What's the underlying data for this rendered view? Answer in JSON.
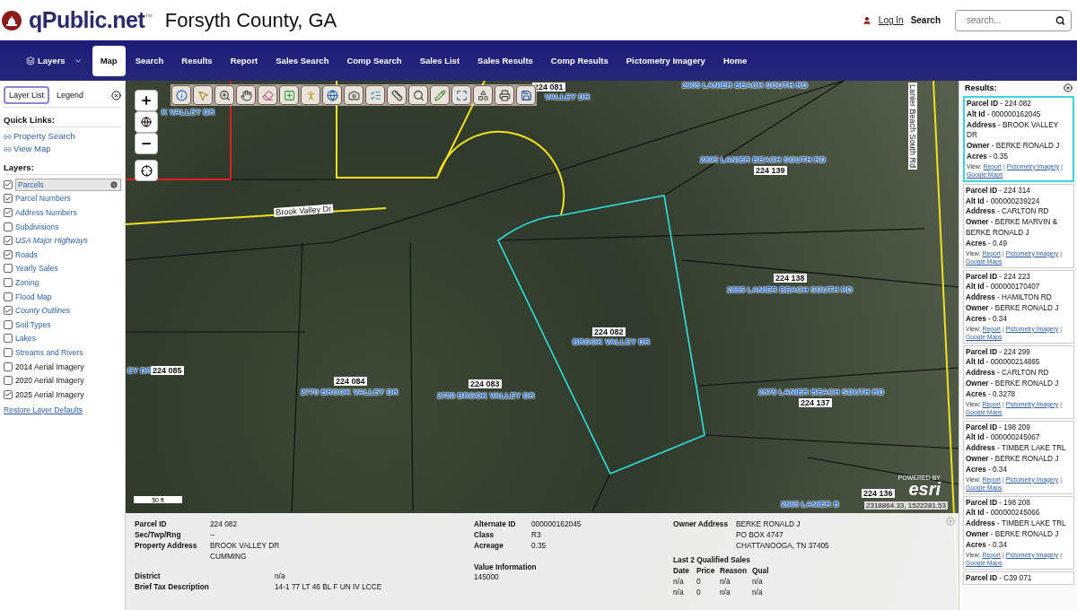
{
  "header": {
    "brand": "qPublic.net$^{™}$",
    "county": "Forsyth County, GA",
    "login": "Log In",
    "search_label": "Search",
    "search": {
      "placeholder": "search..."
    }
  },
  "nav": [
    {
      "label": "Layers",
      "kind": "dropdown",
      "selected": false
    },
    {
      "label": "Map",
      "kind": "link",
      "selected": true
    },
    {
      "label": "Search",
      "kind": "link",
      "selected": false
    },
    {
      "label": "Results",
      "kind": "link",
      "selected": false
    },
    {
      "label": "Report",
      "kind": "link",
      "selected": false
    },
    {
      "label": "Sales Search",
      "kind": "link",
      "selected": false
    },
    {
      "label": "Comp Search",
      "kind": "link",
      "selected": false
    },
    {
      "label": "Sales List",
      "kind": "link",
      "selected": false
    },
    {
      "label": "Sales Results",
      "kind": "link",
      "selected": false
    },
    {
      "label": "Comp Results",
      "kind": "link",
      "selected": false
    },
    {
      "label": "Pictometry Imagery",
      "kind": "link",
      "selected": false
    },
    {
      "label": "Home",
      "kind": "link",
      "selected": false
    }
  ],
  "sidebar": {
    "tabs": [
      {
        "label": "Layer List",
        "selected": true
      },
      {
        "label": "Legend",
        "selected": false
      }
    ],
    "quick_links_title": "Quick Links:",
    "quick_links": [
      "Property Search",
      "View Map"
    ],
    "layers_title": "Layers:",
    "layers": [
      {
        "label": "Parcels",
        "checked": true,
        "selected": true,
        "italic": false,
        "kind": "layer"
      },
      {
        "label": "Parcel Numbers",
        "checked": true,
        "selected": false,
        "italic": false,
        "kind": "layer"
      },
      {
        "label": "Address Numbers",
        "checked": true,
        "selected": false,
        "italic": false,
        "kind": "layer"
      },
      {
        "label": "Subdivisions",
        "checked": false,
        "selected": false,
        "italic": false,
        "kind": "layer"
      },
      {
        "label": "USA Major Highways",
        "checked": true,
        "selected": false,
        "italic": true,
        "kind": "layer"
      },
      {
        "label": "Roads",
        "checked": true,
        "selected": false,
        "italic": false,
        "kind": "layer"
      },
      {
        "label": "Yearly Sales",
        "checked": false,
        "selected": false,
        "italic": false,
        "kind": "layer"
      },
      {
        "label": "Zoning",
        "checked": false,
        "selected": false,
        "italic": false,
        "kind": "layer"
      },
      {
        "label": "Flood Map",
        "checked": false,
        "selected": false,
        "italic": false,
        "kind": "layer"
      },
      {
        "label": "County Outlines",
        "checked": true,
        "selected": false,
        "italic": true,
        "kind": "layer"
      },
      {
        "label": "Soil Types",
        "checked": false,
        "selected": false,
        "italic": false,
        "kind": "layer"
      },
      {
        "label": "Lakes",
        "checked": false,
        "selected": false,
        "italic": false,
        "kind": "layer"
      },
      {
        "label": "Streams and Rivers",
        "checked": false,
        "selected": false,
        "italic": false,
        "kind": "layer"
      },
      {
        "label": "2014 Aerial Imagery",
        "checked": false,
        "selected": false,
        "italic": false,
        "kind": "basemap"
      },
      {
        "label": "2020 Aerial Imagery",
        "checked": false,
        "selected": false,
        "italic": false,
        "kind": "basemap"
      },
      {
        "label": "2025 Aerial Imagery",
        "checked": true,
        "selected": false,
        "italic": false,
        "kind": "basemap"
      }
    ],
    "restore": "Restore Layer Defaults"
  },
  "map": {
    "labels": [
      {
        "text": "K VALLEY DR",
        "kind": "address"
      },
      {
        "text": "224  081",
        "kind": "number"
      },
      {
        "text": "VALLEY DR",
        "kind": "address"
      },
      {
        "text": "2905 LANIER BEACH SOUTH RD",
        "kind": "address"
      },
      {
        "text": "2895 LANIER BEACH SOUTH RD",
        "kind": "address"
      },
      {
        "text": "224  139",
        "kind": "number"
      },
      {
        "text": "224  138",
        "kind": "number"
      },
      {
        "text": "2885 LANIER BEACH SOUTH RD",
        "kind": "address"
      },
      {
        "text": "224  082",
        "kind": "number"
      },
      {
        "text": "BROOK VALLEY DR",
        "kind": "address"
      },
      {
        "text": "EY DR",
        "kind": "address"
      },
      {
        "text": "224  085",
        "kind": "number"
      },
      {
        "text": "224  084",
        "kind": "number"
      },
      {
        "text": "2770 BROOK VALLEY DR",
        "kind": "address"
      },
      {
        "text": "224  083",
        "kind": "number"
      },
      {
        "text": "2780 BROOK VALLEY DR",
        "kind": "address"
      },
      {
        "text": "2875 LANIER BEACH SOUTH RD",
        "kind": "address"
      },
      {
        "text": "224  137",
        "kind": "number"
      },
      {
        "text": "224  136",
        "kind": "number"
      },
      {
        "text": "2865 LANIER B",
        "kind": "address"
      },
      {
        "text": "Brook Valley Dr",
        "kind": "road"
      },
      {
        "text": "Lanier Beach South Rd",
        "kind": "road"
      }
    ],
    "scale": "50 ft",
    "coordinates": "2318864.33, 1522281.53",
    "esri_caption": "POWERED BY",
    "esri": "esri"
  },
  "info": {
    "col1": [
      {
        "label": "Parcel ID",
        "value": [
          "224 082"
        ]
      },
      {
        "label": "Sec/Twp/Rng",
        "value": [
          "--"
        ]
      },
      {
        "label": "Property Address",
        "value": [
          "BROOK VALLEY DR",
          "CUMMING"
        ]
      }
    ],
    "col1b": [
      {
        "label": "District",
        "value": [
          "n/a"
        ]
      },
      {
        "label": "Brief Tax Description",
        "value": [
          "14-1 77 LT 46 BL F UN IV LCCE"
        ]
      }
    ],
    "col2": [
      {
        "label": "Alternate ID",
        "value": [
          "000000162045"
        ]
      },
      {
        "label": "Class",
        "value": [
          "R3"
        ]
      },
      {
        "label": "Acreage",
        "value": [
          "0.35"
        ]
      }
    ],
    "value_title": "Value Information",
    "value": "145000",
    "col3": [
      {
        "label": "Owner Address",
        "value": [
          "BERKE RONALD J",
          "PO BOX 4747",
          "CHATTANOOGA, TN 37405"
        ]
      }
    ],
    "sales_title": "Last 2 Qualified Sales",
    "sales": {
      "columns": [
        "Date",
        "Price",
        "Reason",
        "Qual"
      ],
      "rows": [
        [
          "n/a",
          "0",
          "n/a",
          "n/a"
        ],
        [
          "n/a",
          "0",
          "n/a",
          "n/a"
        ]
      ]
    }
  },
  "results": {
    "title": "Results:",
    "cards": [
      {
        "selected": true,
        "lines": [
          "**Parcel ID** - 224 082",
          "**Alt Id** - 000000162045",
          "**Address** - BROOK VALLEY DR",
          "**Owner** - BERKE RONALD J",
          "**Acres** - 0.35"
        ],
        "links": [
          {
            "kind": "label",
            "text": "View:"
          },
          {
            "kind": "link",
            "text": "Report"
          },
          {
            "kind": "separator",
            "text": "|"
          },
          {
            "kind": "link",
            "text": "Pictometry Imagery"
          },
          {
            "kind": "separator",
            "text": "|"
          },
          {
            "kind": "link",
            "text": "Google Maps"
          }
        ]
      },
      {
        "selected": false,
        "lines": [
          "**Parcel ID** - 224 314",
          "**Alt Id** - 000000239224",
          "**Address** - CARLTON RD",
          "**Owner** - BERKE MARVIN & BERKE RONALD J",
          "**Acres** - 0.49"
        ],
        "links": [
          {
            "kind": "label",
            "text": "View:"
          },
          {
            "kind": "link",
            "text": "Report"
          },
          {
            "kind": "separator",
            "text": "|"
          },
          {
            "kind": "link",
            "text": "Pictometry Imagery"
          },
          {
            "kind": "separator",
            "text": "|"
          },
          {
            "kind": "link",
            "text": "Google Maps"
          }
        ]
      },
      {
        "selected": false,
        "lines": [
          "**Parcel ID** - 224 223",
          "**Alt Id** - 000000170407",
          "**Address** - HAMILTON RD",
          "**Owner** - BERKE RONALD J",
          "**Acres** - 0.34"
        ],
        "links": [
          {
            "kind": "label",
            "text": "View:"
          },
          {
            "kind": "link",
            "text": "Report"
          },
          {
            "kind": "separator",
            "text": "|"
          },
          {
            "kind": "link",
            "text": "Pictometry Imagery"
          },
          {
            "kind": "separator",
            "text": "|"
          },
          {
            "kind": "link",
            "text": "Google Maps"
          }
        ]
      },
      {
        "selected": false,
        "lines": [
          "**Parcel ID** - 224 299",
          "**Alt Id** - 000000214865",
          "**Address** - CARLTON RD",
          "**Owner** - BERKE RONALD J",
          "**Acres** - 0.3278"
        ],
        "links": [
          {
            "kind": "label",
            "text": "View:"
          },
          {
            "kind": "link",
            "text": "Report"
          },
          {
            "kind": "separator",
            "text": "|"
          },
          {
            "kind": "link",
            "text": "Pictometry Imagery"
          },
          {
            "kind": "separator",
            "text": "|"
          },
          {
            "kind": "link",
            "text": "Google Maps"
          }
        ]
      },
      {
        "selected": false,
        "lines": [
          "**Parcel ID** - 198 209",
          "**Alt Id** - 000000245067",
          "**Address** - TIMBER LAKE TRL",
          "**Owner** - BERKE RONALD J",
          "**Acres** - 0.34"
        ],
        "links": [
          {
            "kind": "label",
            "text": "View:"
          },
          {
            "kind": "link",
            "text": "Report"
          },
          {
            "kind": "separator",
            "text": "|"
          },
          {
            "kind": "link",
            "text": "Pictometry Imagery"
          },
          {
            "kind": "separator",
            "text": "|"
          },
          {
            "kind": "link",
            "text": "Google Maps"
          }
        ]
      },
      {
        "selected": false,
        "lines": [
          "**Parcel ID** - 198 208",
          "**Alt Id** - 000000245066",
          "**Address** - TIMBER LAKE TRL",
          "**Owner** - BERKE RONALD J",
          "**Acres** - 0.34"
        ],
        "links": [
          {
            "kind": "label",
            "text": "View:"
          },
          {
            "kind": "link",
            "text": "Report"
          },
          {
            "kind": "separator",
            "text": "|"
          },
          {
            "kind": "link",
            "text": "Pictometry Imagery"
          },
          {
            "kind": "separator",
            "text": "|"
          },
          {
            "kind": "link",
            "text": "Google Maps"
          }
        ]
      },
      {
        "selected": false,
        "lines": [
          "**Parcel ID** - C39 071"
        ]
      }
    ]
  }
}
